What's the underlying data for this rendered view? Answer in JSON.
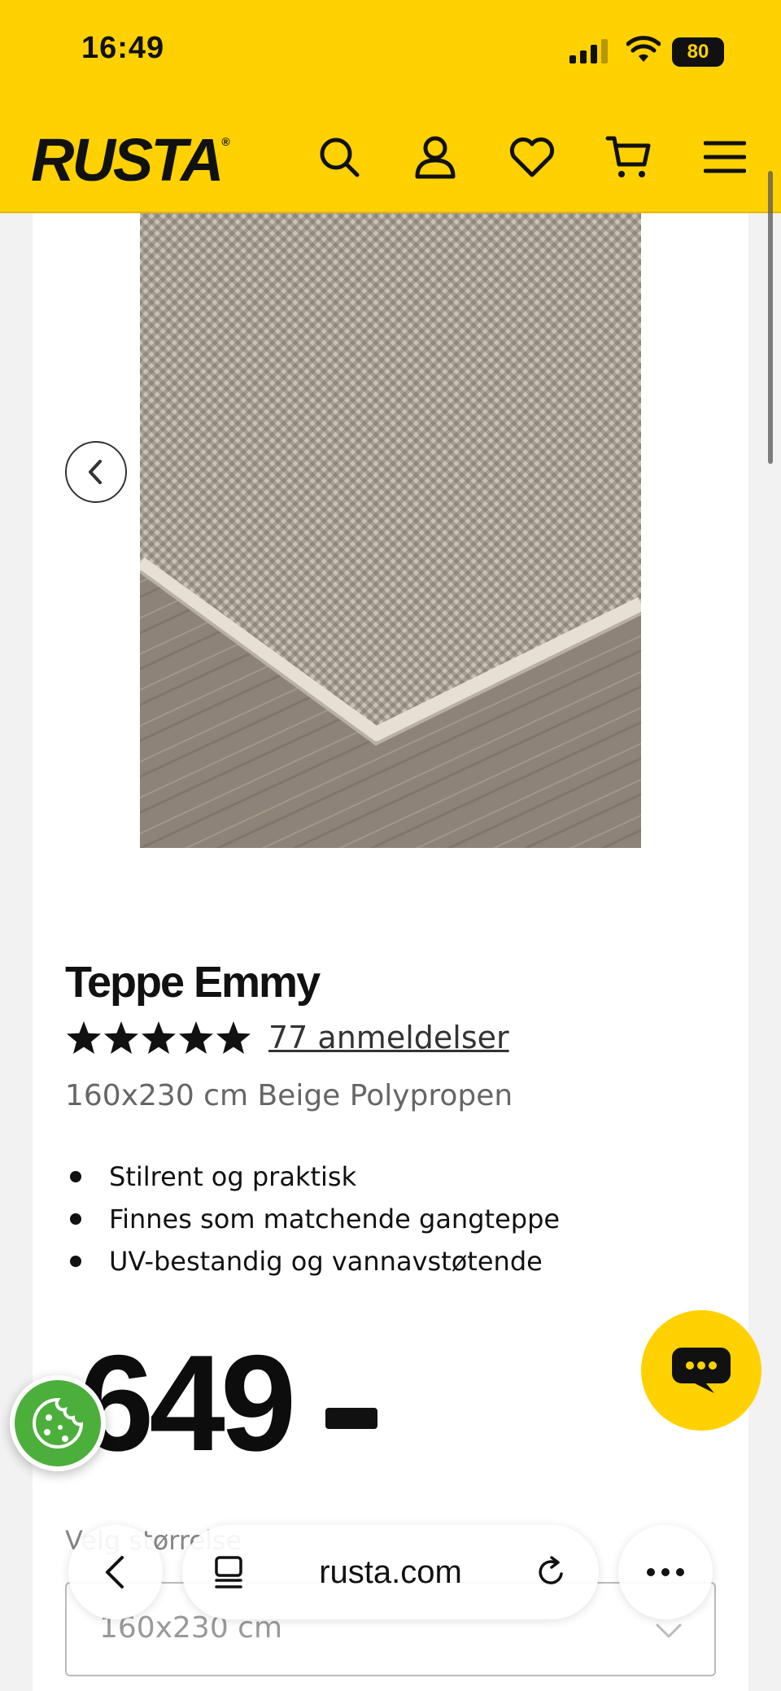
{
  "status": {
    "time": "16:49",
    "battery": "80"
  },
  "header": {
    "logo": "RUSTA",
    "logo_mark": "®",
    "icons": [
      "search-icon",
      "account-icon",
      "wishlist-icon",
      "cart-icon",
      "menu-icon"
    ]
  },
  "product": {
    "title": "Teppe Emmy",
    "rating_stars": 5,
    "reviews_link": "77 anmeldelser",
    "subtitle": "160x230 cm Beige Polypropen",
    "features": [
      "Stilrent og praktisk",
      "Finnes som matchende gangteppe",
      "UV-bestandig og vannavstøtende"
    ],
    "price": "649"
  },
  "size_selector": {
    "label": "Velg størrelse",
    "value": "160x230 cm"
  },
  "browser": {
    "url": "rusta.com"
  },
  "colors": {
    "brand_yellow": "#ffd100",
    "cookie_green": "#4caf3b"
  }
}
